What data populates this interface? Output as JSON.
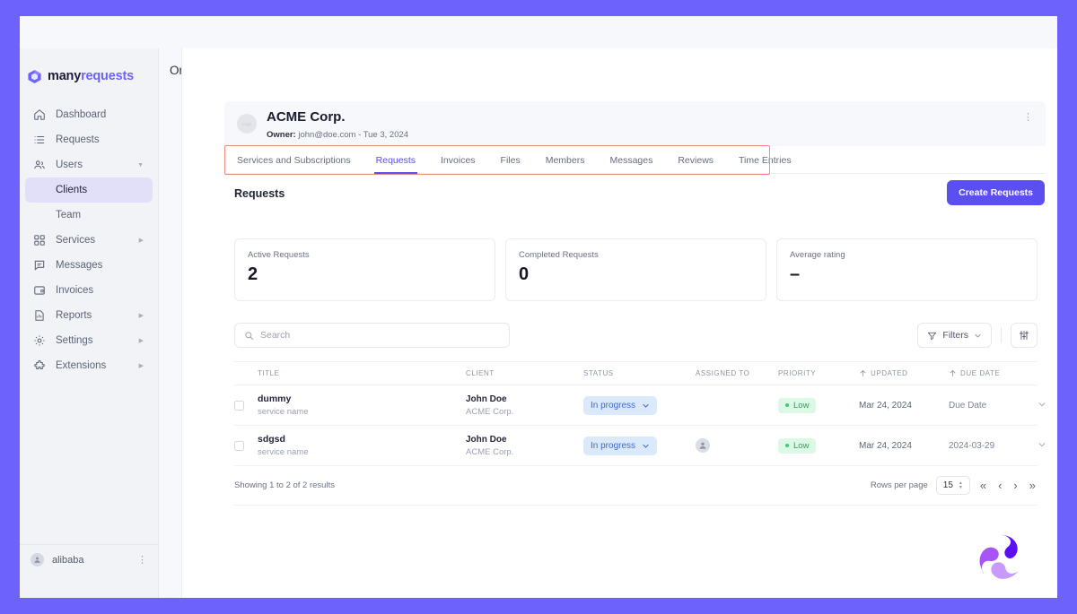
{
  "brand": {
    "logo_many": "many",
    "logo_requests": "requests",
    "accent": "#5b4ff0",
    "frame_color": "#6d63fc"
  },
  "sidebar": {
    "items": [
      {
        "label": "Dashboard",
        "icon": "home-icon",
        "expandable": false
      },
      {
        "label": "Requests",
        "icon": "list-icon",
        "expandable": false
      },
      {
        "label": "Users",
        "icon": "users-icon",
        "expandable": true
      },
      {
        "label": "Services",
        "icon": "grid-icon",
        "expandable": true
      },
      {
        "label": "Messages",
        "icon": "chat-icon",
        "expandable": false
      },
      {
        "label": "Invoices",
        "icon": "invoice-icon",
        "expandable": false
      },
      {
        "label": "Reports",
        "icon": "report-icon",
        "expandable": true
      },
      {
        "label": "Settings",
        "icon": "gear-icon",
        "expandable": true
      },
      {
        "label": "Extensions",
        "icon": "puzzle-icon",
        "expandable": true
      }
    ],
    "sub_items": [
      {
        "label": "Clients",
        "active": true
      },
      {
        "label": "Team",
        "active": false
      }
    ],
    "user": {
      "name": "alibaba"
    }
  },
  "header": {
    "page_title": "Organizations Details"
  },
  "organization": {
    "avatar_text": "Logo",
    "name": "ACME Corp.",
    "owner_label": "Owner:",
    "owner_email": "john@doe.com",
    "owner_date": "- Tue 3, 2024"
  },
  "tabs": [
    {
      "label": "Services and Subscriptions",
      "active": false
    },
    {
      "label": "Requests",
      "active": true
    },
    {
      "label": "Invoices",
      "active": false
    },
    {
      "label": "Files",
      "active": false
    },
    {
      "label": "Members",
      "active": false
    },
    {
      "label": "Messages",
      "active": false
    },
    {
      "label": "Reviews",
      "active": false
    },
    {
      "label": "Time Entries",
      "active": false
    }
  ],
  "section": {
    "title": "Requests",
    "create_button": "Create Requests"
  },
  "stats": [
    {
      "label": "Active Requests",
      "value": "2"
    },
    {
      "label": "Completed Requests",
      "value": "0"
    },
    {
      "label": "Average rating",
      "value": "–"
    }
  ],
  "toolbar": {
    "search_placeholder": "Search",
    "search_value": "",
    "filters_label": "Filters"
  },
  "table": {
    "columns": [
      "TITLE",
      "CLIENT",
      "STATUS",
      "ASSIGNED TO",
      "PRIORITY",
      "UPDATED",
      "DUE DATE"
    ],
    "rows": [
      {
        "title": "dummy",
        "subtitle": "service name",
        "client_name": "John Doe",
        "client_org": "ACME Corp.",
        "status": "In progress",
        "assigned_to": "",
        "has_avatar": false,
        "priority": "Low",
        "updated": "Mar 24, 2024",
        "due_date": "Due Date"
      },
      {
        "title": "sdgsd",
        "subtitle": "service name",
        "client_name": "John Doe",
        "client_org": "ACME Corp.",
        "status": "In progress",
        "assigned_to": "",
        "has_avatar": true,
        "priority": "Low",
        "updated": "Mar 24, 2024",
        "due_date": "2024-03-29"
      }
    ]
  },
  "pagination": {
    "showing": "Showing 1 to 2 of 2 results",
    "rows_per_page_label": "Rows per page",
    "rows_per_page_value": "15"
  }
}
